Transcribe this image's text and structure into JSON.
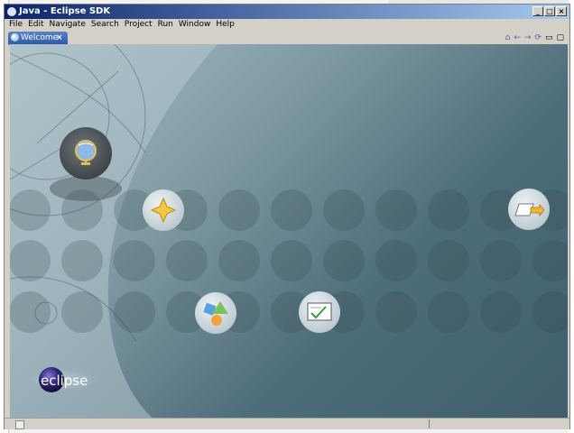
{
  "window": {
    "title": "Java - Eclipse SDK",
    "buttons": [
      "_",
      "□",
      "×"
    ]
  },
  "menu": [
    "File",
    "Edit",
    "Navigate",
    "Search",
    "Project",
    "Run",
    "Window",
    "Help"
  ],
  "tabs": [
    {
      "label": "Welcome",
      "close": "×",
      "active": true
    }
  ],
  "welcome": {
    "logo_text": "eclipse",
    "items": [
      {
        "name": "overview",
        "icon": "globe-icon"
      },
      {
        "name": "whats-new",
        "icon": "star-icon"
      },
      {
        "name": "samples",
        "icon": "shapes-icon"
      },
      {
        "name": "tutorials",
        "icon": "checklist-icon"
      },
      {
        "name": "workbench",
        "icon": "arrow-folder-icon"
      }
    ]
  },
  "toolbar_icons": [
    "home-icon",
    "back-icon",
    "forward-icon",
    "sync-icon",
    "minimize-icon",
    "maximize-icon"
  ]
}
